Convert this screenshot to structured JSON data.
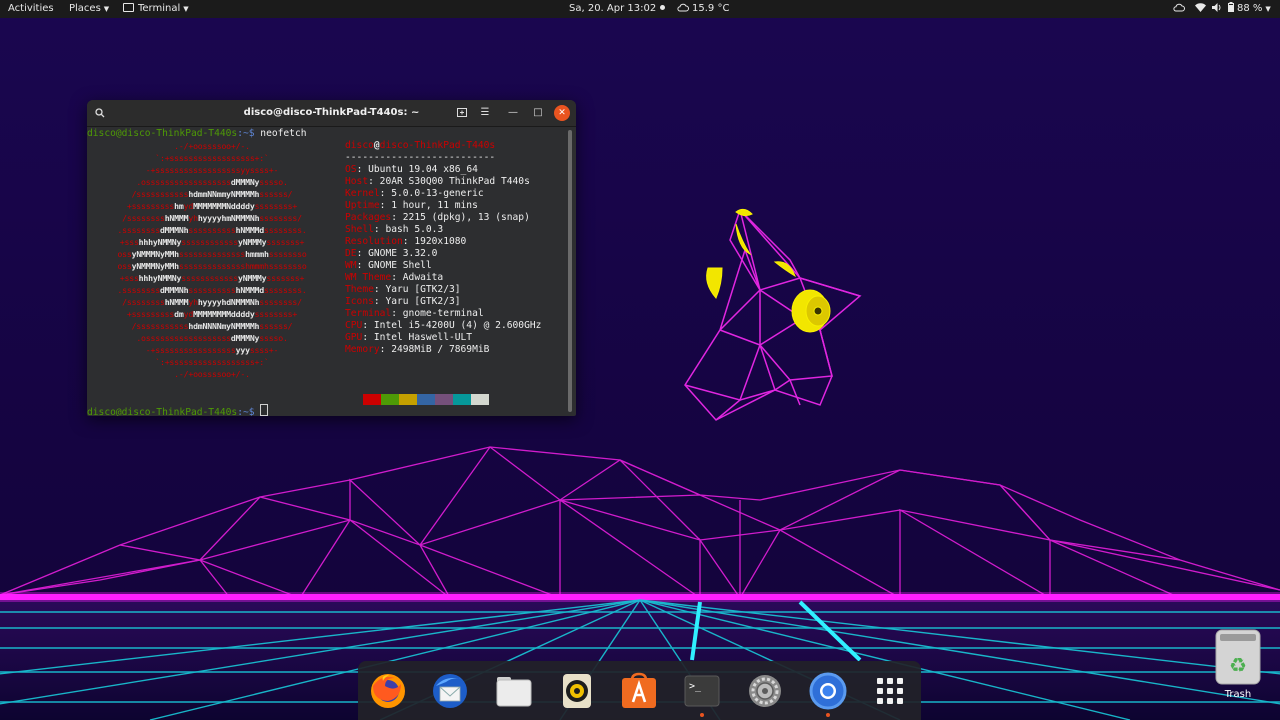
{
  "topbar": {
    "activities": "Activities",
    "places": "Places",
    "app": "Terminal",
    "clock": "Sa, 20. Apr  13:02",
    "weather": "15.9 °C",
    "battery": "88 %",
    "icons": [
      "cloud-icon",
      "wifi-icon",
      "volume-icon",
      "battery-icon"
    ]
  },
  "terminal": {
    "title": "disco@disco-ThinkPad-T440s: ~",
    "prompt_user": "disco@disco-ThinkPad-T440s",
    "prompt_path": ":~$ ",
    "command": "neofetch",
    "header": {
      "user": "disco",
      "at": "@",
      "host": "disco-ThinkPad-T440s"
    },
    "separator": "--------------------------",
    "info": [
      {
        "key": "OS",
        "value": "Ubuntu 19.04 x86_64"
      },
      {
        "key": "Host",
        "value": "20AR S30Q00 ThinkPad T440s"
      },
      {
        "key": "Kernel",
        "value": "5.0.0-13-generic"
      },
      {
        "key": "Uptime",
        "value": "1 hour, 11 mins"
      },
      {
        "key": "Packages",
        "value": "2215 (dpkg), 13 (snap)"
      },
      {
        "key": "Shell",
        "value": "bash 5.0.3"
      },
      {
        "key": "Resolution",
        "value": "1920x1080"
      },
      {
        "key": "DE",
        "value": "GNOME 3.32.0"
      },
      {
        "key": "WM",
        "value": "GNOME Shell"
      },
      {
        "key": "WM Theme",
        "value": "Adwaita"
      },
      {
        "key": "Theme",
        "value": "Yaru [GTK2/3]"
      },
      {
        "key": "Icons",
        "value": "Yaru [GTK2/3]"
      },
      {
        "key": "Terminal",
        "value": "gnome-terminal"
      },
      {
        "key": "CPU",
        "value": "Intel i5-4200U (4) @ 2.600GHz"
      },
      {
        "key": "GPU",
        "value": "Intel Haswell-ULT"
      },
      {
        "key": "Memory",
        "value": "2498MiB / 7869MiB"
      }
    ],
    "logo": [
      [
        ".-/+oossssoo+/-.",
        ""
      ],
      [
        "`:+ssssssssssssssssss+:`",
        ""
      ],
      [
        "-+ssssssssssssssssssyyssss+-",
        ""
      ],
      [
        ".ossssssssssssssssss",
        "dMMMNy",
        "sssso."
      ],
      [
        "/sssssssssss",
        "hdmmNNmmyNMMMMh",
        "ssssss/"
      ],
      [
        "+sssssssss",
        "hm",
        "yd",
        "MMMMMMMNddddy",
        "ssssssss+"
      ],
      [
        "/ssssssss",
        "hNMMM",
        "yh",
        "hyyyyhmNMMMNh",
        "ssssssss/"
      ],
      [
        ".ssssssss",
        "dMMMNh",
        "ssssssssss",
        "hNMMMd",
        "ssssssss."
      ],
      [
        "+sss",
        "hhhyNMMNy",
        "ssssssssssss",
        "yNMMMy",
        "sssssss+"
      ],
      [
        "oss",
        "yNMMMNyMMh",
        "ssssssssssssss",
        "hmmmh",
        "ssssssso"
      ],
      [
        "oss",
        "yNMMMNyMMh",
        "sssssssssssssshmmmhssssssso",
        ""
      ],
      [
        "+sss",
        "hhhyNMMNy",
        "ssssssssssss",
        "yNMMMy",
        "sssssss+"
      ],
      [
        ".ssssssss",
        "dMMMNh",
        "ssssssssss",
        "hNMMMd",
        "ssssssss."
      ],
      [
        "/ssssssss",
        "hNMMM",
        "yh",
        "hyyyyhdNMMMNh",
        "ssssssss/"
      ],
      [
        "+sssssssss",
        "dm",
        "yd",
        "MMMMMMMMddddy",
        "ssssssss+"
      ],
      [
        "/sssssssssss",
        "hdmNNNNmyNMMMMh",
        "ssssss/"
      ],
      [
        ".ossssssssssssssssss",
        "dMMMNy",
        "sssso."
      ],
      [
        "-+sssssssssssssssss",
        "yyy",
        "ssss+-"
      ],
      [
        "`:+ssssssssssssssssss+:`",
        ""
      ],
      [
        ".-/+oossssoo+/-.",
        ""
      ]
    ],
    "palette": [
      "#cc0000",
      "#4e9a06",
      "#c4a000",
      "#3465a4",
      "#75507b",
      "#06989a",
      "#d3d7cf"
    ]
  },
  "dock": {
    "apps": [
      "Firefox",
      "Thunderbird",
      "Files",
      "Rhythmbox",
      "Ubuntu Software",
      "Terminal",
      "Settings",
      "Chromium",
      "Show Applications"
    ]
  },
  "desktop": {
    "trash_label": "Trash"
  }
}
